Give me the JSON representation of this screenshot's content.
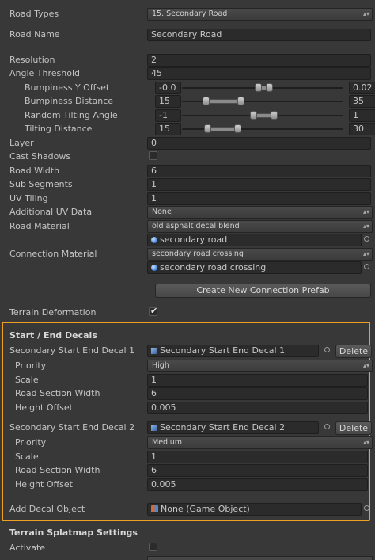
{
  "road_types": {
    "label": "Road Types",
    "value": "15. Secondary Road"
  },
  "road_name": {
    "label": "Road Name",
    "value": "Secondary Road"
  },
  "resolution": {
    "label": "Resolution",
    "value": "2"
  },
  "angle_threshold": {
    "label": "Angle Threshold",
    "value": "45"
  },
  "bump_y": {
    "label": "Bumpiness Y Offset",
    "min": "-0.0",
    "max": "0.02"
  },
  "bump_dist": {
    "label": "Bumpiness Distance",
    "min": "15",
    "max": "35"
  },
  "tilt_angle": {
    "label": "Random Tilting Angle",
    "min": "-1",
    "max": "1"
  },
  "tilt_dist": {
    "label": "Tilting Distance",
    "min": "15",
    "max": "30"
  },
  "layer": {
    "label": "Layer",
    "value": "0"
  },
  "cast_shadows": {
    "label": "Cast Shadows"
  },
  "road_width": {
    "label": "Road Width",
    "value": "6"
  },
  "sub_segments": {
    "label": "Sub Segments",
    "value": "1"
  },
  "uv_tiling": {
    "label": "UV Tiling",
    "value": "1"
  },
  "additional_uv": {
    "label": "Additional UV Data",
    "value": "None"
  },
  "road_material": {
    "label": "Road Material",
    "value": "old asphalt decal blend",
    "object": "secondary road"
  },
  "connection_material": {
    "label": "Connection Material",
    "value": "secondary road crossing",
    "object": "secondary road crossing"
  },
  "create_button": "Create New Connection Prefab",
  "terrain_deformation": {
    "label": "Terrain Deformation"
  },
  "decals": {
    "title": "Start / End Decals",
    "decal1": {
      "label": "Secondary Start End Decal 1",
      "object": "Secondary Start End Decal 1",
      "delete": "Delete",
      "priority_label": "Priority",
      "priority": "High",
      "scale_label": "Scale",
      "scale": "1",
      "width_label": "Road Section Width",
      "width": "6",
      "height_label": "Height Offset",
      "height": "0.005"
    },
    "decal2": {
      "label": "Secondary Start End Decal 2",
      "object": "Secondary Start End Decal 2",
      "delete": "Delete",
      "priority_label": "Priority",
      "priority": "Medium",
      "scale_label": "Scale",
      "scale": "1",
      "width_label": "Road Section Width",
      "width": "6",
      "height_label": "Height Offset",
      "height": "0.005"
    },
    "add_label": "Add Decal Object",
    "add_value": "None (Game Object)"
  },
  "splatmap": {
    "title": "Terrain Splatmap Settings",
    "activate_label": "Activate"
  },
  "colors": {
    "accent": "#f0a020",
    "background": "#383838",
    "field": "#2b2b2b"
  }
}
